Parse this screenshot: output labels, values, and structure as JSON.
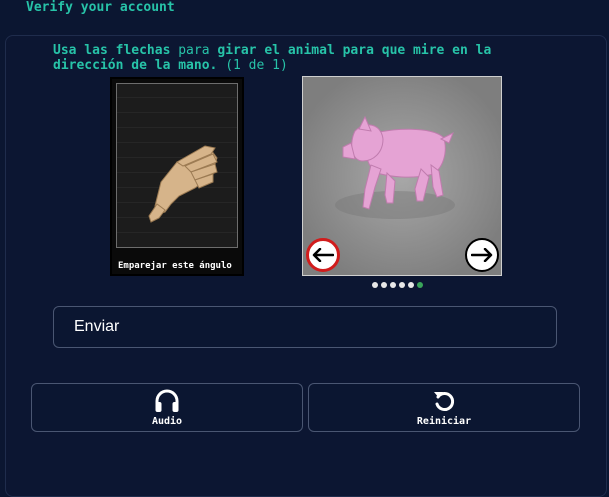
{
  "header": {
    "title": "Verify your account"
  },
  "instruction": {
    "part1": "Usa las flechas",
    "part2": " para ",
    "part3": "girar el animal",
    "part4": " para que mire en la dirección de la mano.",
    "part5": " (1 de 1)"
  },
  "reference": {
    "label": "Emparejar este ángulo"
  },
  "viewer": {
    "left_icon": "arrow-left-icon",
    "right_icon": "arrow-right-icon",
    "dots_total": 6,
    "active_dot": 6
  },
  "submit": {
    "label": "Enviar"
  },
  "controls": {
    "audio_label": "Audio",
    "reset_label": "Reiniciar"
  },
  "colors": {
    "accent": "#27c3a8",
    "background": "#0b1631",
    "arrow_left_border": "#d11c1c",
    "active_dot": "#3aa55a"
  }
}
